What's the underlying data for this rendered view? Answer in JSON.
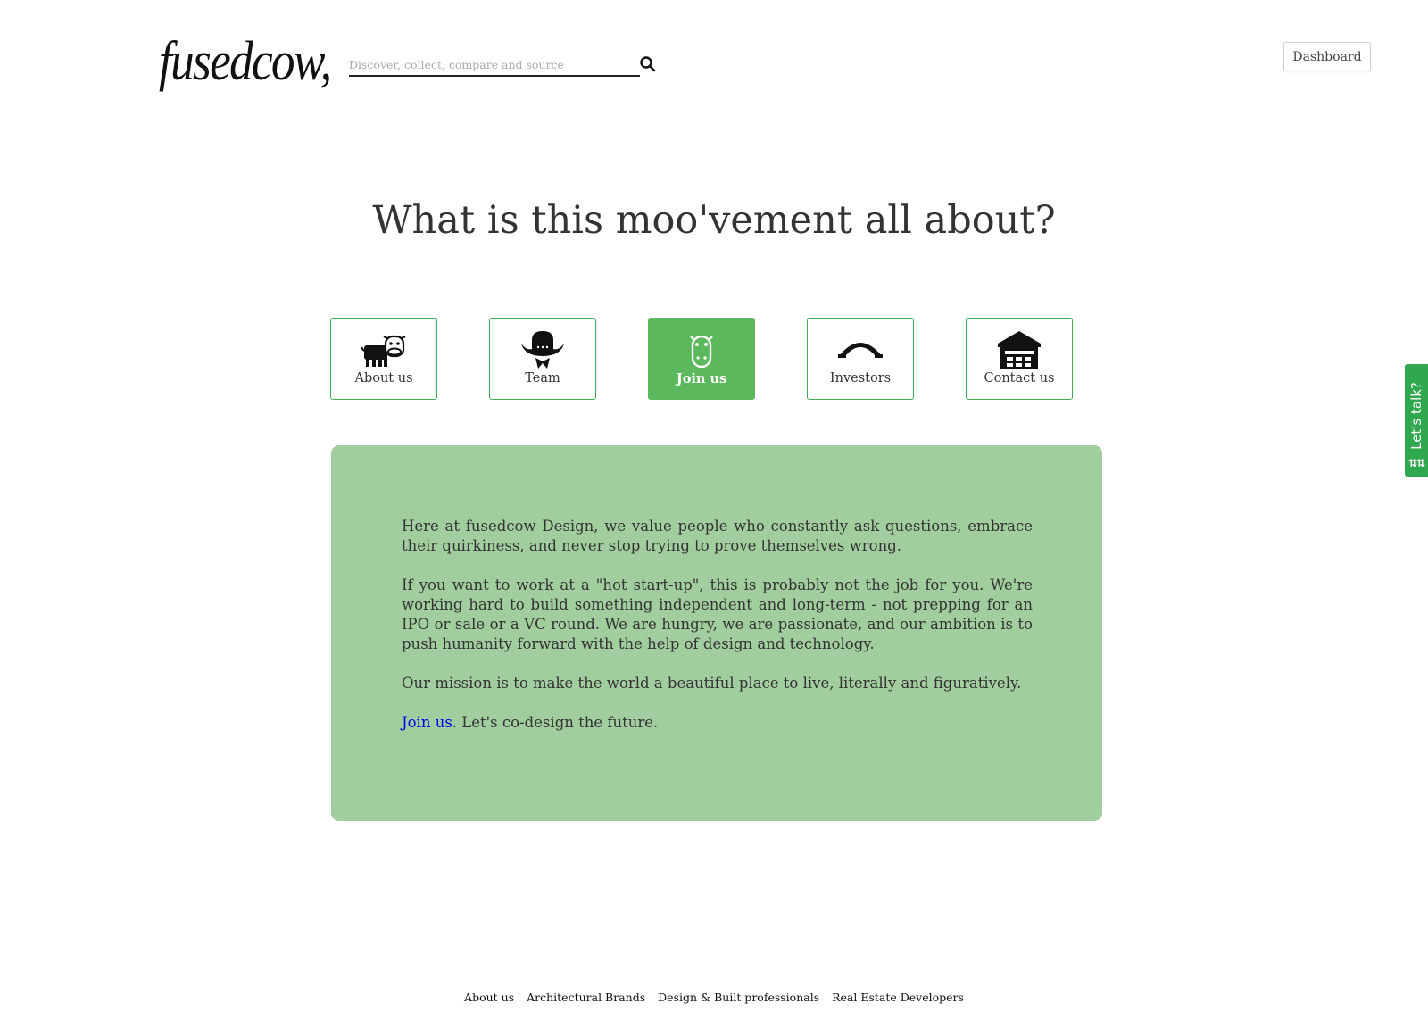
{
  "header": {
    "logo": "fusedcow,",
    "search_placeholder": "Discover, collect, compare and source",
    "dashboard_label": "Dashboard"
  },
  "headline": "What is this moo'vement all about?",
  "tabs": [
    {
      "label": "About us",
      "icon": "cow-icon",
      "active": false
    },
    {
      "label": "Team",
      "icon": "cowboy-hat-icon",
      "active": false
    },
    {
      "label": "Join us",
      "icon": "cow-face-icon",
      "active": true
    },
    {
      "label": "Investors",
      "icon": "arch-icon",
      "active": false
    },
    {
      "label": "Contact us",
      "icon": "barn-icon",
      "active": false
    }
  ],
  "panel": {
    "p1": "Here at fusedcow Design, we value people who constantly ask questions, embrace their quirkiness, and never stop trying to prove themselves wrong.",
    "p2": "If you want to work at a \"hot start-up\", this is probably not the job for you. We're working hard to build something independent and long-term - not prepping for an IPO or sale or a VC round. We are hungry, we are passionate, and our ambition is to push humanity forward with the help of design and technology.",
    "p3": "Our mission is to make the world a beautiful place to live, literally and figuratively.",
    "p4_link": "Join us",
    "p4_rest": ". Let's co-design the future."
  },
  "side_tab": {
    "label": "Let's talk?",
    "icon": "up-down-arrows-icon"
  },
  "footer": {
    "links": [
      "About us",
      "Architectural Brands",
      "Design & Built professionals",
      "Real Estate Developers"
    ]
  },
  "colors": {
    "accent": "#5cb85c",
    "panel": "#a2cd9e",
    "border": "#3fae5a",
    "side_tab": "#2fa84f"
  }
}
